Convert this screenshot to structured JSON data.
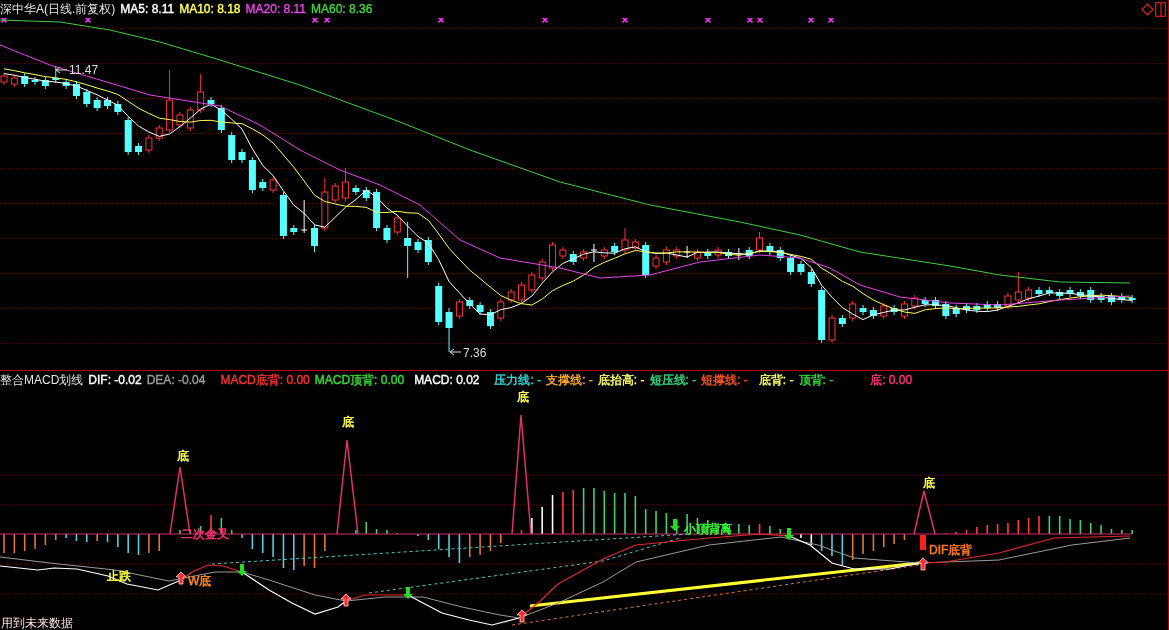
{
  "price_panel": {
    "title": "深中华A(日线.前复权)",
    "indicators": [
      {
        "text": "MA5: 8.11",
        "color": "#ffffff"
      },
      {
        "text": "MA10: 8.18",
        "color": "#ffff55"
      },
      {
        "text": "MA20: 8.11",
        "color": "#e645e6"
      },
      {
        "text": "MA60: 8.36",
        "color": "#3fcf3f"
      }
    ],
    "high_label": "11.47",
    "low_label": "7.36"
  },
  "macd_panel": {
    "title": "整合MACD划线",
    "readouts": [
      {
        "text": "DIF: -0.02",
        "color": "#ffffff"
      },
      {
        "text": "DEA: -0.04",
        "color": "#9a9a9a"
      },
      {
        "text": "MACD底背: 0.00",
        "color": "#ff3030"
      },
      {
        "text": "MACD顶背: 0.00",
        "color": "#33dd33"
      },
      {
        "text": "MACD: 0.02",
        "color": "#ffffff"
      },
      {
        "text": "压力线: -",
        "color": "#33dddd"
      },
      {
        "text": "支撑线: -",
        "color": "#ffaa33"
      },
      {
        "text": "底抬高: -",
        "color": "#ffff66"
      },
      {
        "text": "短压线: -",
        "color": "#33dd88"
      },
      {
        "text": "短撑线: -",
        "color": "#ff5522"
      },
      {
        "text": "底背: -",
        "color": "#ffff66"
      },
      {
        "text": "顶背: -",
        "color": "#33dd33"
      },
      {
        "text": "底: 0.00",
        "color": "#ff3377"
      }
    ],
    "signals": [
      {
        "text": "底",
        "color": "#ffff55"
      },
      {
        "text": "底",
        "color": "#ffff55"
      },
      {
        "text": "底",
        "color": "#ffff55"
      },
      {
        "text": "底",
        "color": "#ffff55"
      },
      {
        "text": "小顶背离",
        "color": "#33ff33"
      },
      {
        "text": "二次金叉",
        "color": "#ff3377"
      },
      {
        "text": "DIF底背",
        "color": "#ff7722"
      },
      {
        "text": "止跌",
        "color": "#ffff33"
      },
      {
        "text": "W底",
        "color": "#ff8822"
      }
    ],
    "note": "用到未来数据"
  }
}
